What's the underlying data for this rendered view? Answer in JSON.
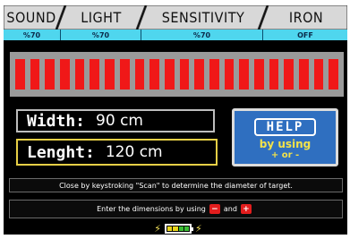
{
  "tabs": [
    {
      "label": "SOUND",
      "value": "%70"
    },
    {
      "label": "LIGHT",
      "value": "%70"
    },
    {
      "label": "SENSITIVITY",
      "value": "%70"
    },
    {
      "label": "IRON",
      "value": "OFF"
    }
  ],
  "level_bar": {
    "segments": 22,
    "color": "#f01818"
  },
  "width": {
    "label": "Width:",
    "value": "90 cm"
  },
  "length": {
    "label": "Lenght:",
    "value": "120 cm"
  },
  "help": {
    "title": "HELP",
    "line2": "by using",
    "line3": "+ or -"
  },
  "info1": "Close by keystroking \"Scan\" to determine the diameter of target.",
  "info2": {
    "prefix": "Enter the dimensions by using",
    "minus": "−",
    "and": "and",
    "plus": "+"
  },
  "battery": {
    "cells": [
      "#e8d41c",
      "#e8d41c",
      "#3cbf36",
      "#3cbf36"
    ]
  },
  "colors": {
    "tab_value_bg": "#4fd6ee",
    "help_bg": "#2f6fc0",
    "length_border": "#e6cf46"
  }
}
